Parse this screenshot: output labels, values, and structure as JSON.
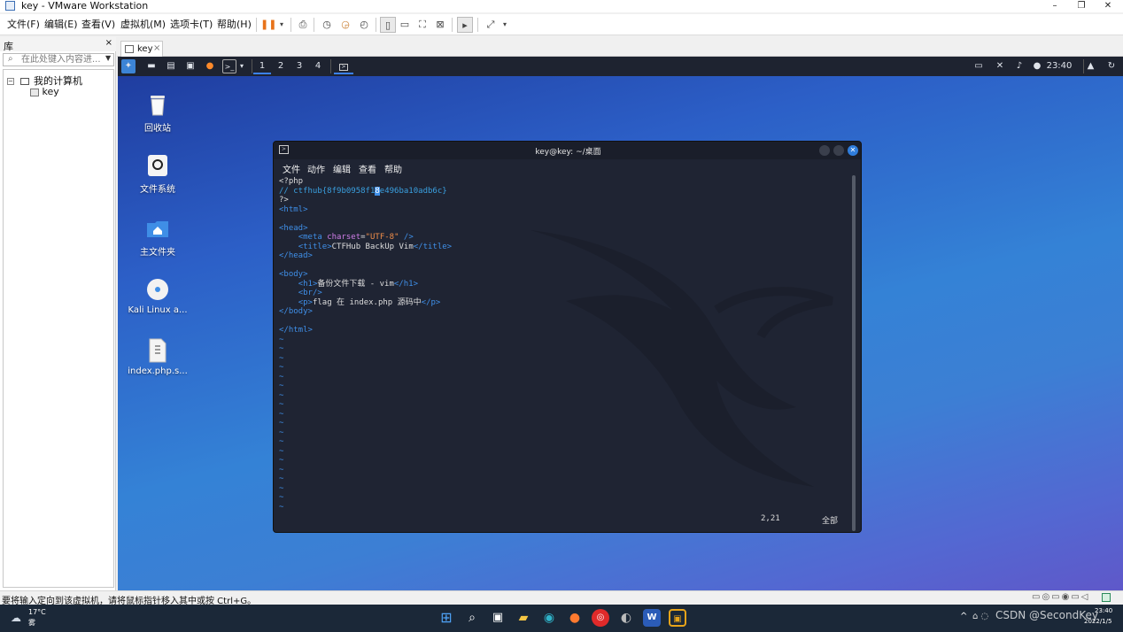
{
  "window": {
    "title": "key - VMware Workstation",
    "controls": {
      "minimize": "–",
      "restore": "❐",
      "close": "✕"
    }
  },
  "menubar": {
    "items": [
      "文件(F)",
      "编辑(E)",
      "查看(V)",
      "虚拟机(M)",
      "选项卡(T)",
      "帮助(H)"
    ]
  },
  "library": {
    "title": "库",
    "close": "×",
    "search_placeholder": "在此处键入内容进...",
    "tree": {
      "root": "我的计算机",
      "child": "key"
    }
  },
  "vm_tab": {
    "label": "key",
    "close": "×"
  },
  "kali_panel": {
    "workspaces": [
      "1",
      "2",
      "3",
      "4"
    ],
    "active_workspace": "1",
    "clock": "23:40"
  },
  "desktop_icons": [
    {
      "label": "回收站",
      "icon": "trash-icon"
    },
    {
      "label": "文件系统",
      "icon": "drive-icon"
    },
    {
      "label": "主文件夹",
      "icon": "home-folder-icon"
    },
    {
      "label": "Kali Linux a...",
      "icon": "disc-icon"
    },
    {
      "label": "index.php.s...",
      "icon": "file-icon"
    }
  ],
  "terminal": {
    "title": "key@key: ~/桌面",
    "menu": [
      "文件",
      "动作",
      "编辑",
      "查看",
      "帮助"
    ],
    "lines": {
      "l1": "<?php",
      "l2_pre": "// ctfhub{8f9b0958f1",
      "l2_cursor": "8",
      "l2_post": "e496ba10adb6c}",
      "l3": "?>",
      "title_text": "CTFHub BackUp Vim",
      "h1_text": "备份文件下载 - vim",
      "p_text": "flag 在 index.php 源码中",
      "charset": "\"UTF-8\""
    },
    "status_pos": "2,21",
    "status_all": "全部"
  },
  "statusbar": {
    "message": "要将输入定向到该虚拟机，请将鼠标指针移入其中或按 Ctrl+G。"
  },
  "taskbar": {
    "weather_temp": "17°C",
    "weather_desc": "雾",
    "time": "23:40",
    "date": "2022/1/5",
    "watermark": "CSDN @SecondKey"
  }
}
